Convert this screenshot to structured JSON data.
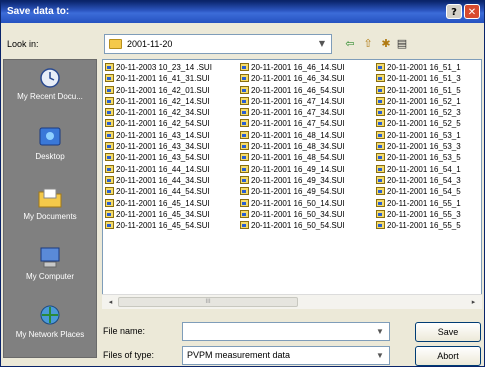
{
  "window": {
    "title": "Save data to:",
    "help": "?",
    "close": "✕"
  },
  "look_in": {
    "label": "Look in:",
    "value": "2001-11-20"
  },
  "toolbar": {
    "back": "⇦",
    "up": "⇧",
    "new_folder": "✱",
    "views": "▤"
  },
  "places": [
    "My Recent Docu...",
    "Desktop",
    "My Documents",
    "My Computer",
    "My Network Places"
  ],
  "files": {
    "col1": [
      "20-11-2003 10_23_14 .SUI",
      "20-11-2001 16_41_31.SUI",
      "20-11-2001 16_42_01.SUI",
      "20-11-2001 16_42_14.SUI",
      "20-11-2001 16_42_34.SUI",
      "20-11-2001 16_42_54.SUI",
      "20-11-2001 16_43_14.SUI",
      "20-11-2001 16_43_34.SUI",
      "20-11-2001 16_43_54.SUI",
      "20-11-2001 16_44_14.SUI",
      "20-11-2001 16_44_34.SUI",
      "20-11-2001 16_44_54.SUI",
      "20-11-2001 16_45_14.SUI",
      "20-11-2001 16_45_34.SUI",
      "20-11-2001 16_45_54.SUI"
    ],
    "col2": [
      "20-11-2001 16_46_14.SUI",
      "20-11-2001 16_46_34.SUI",
      "20-11-2001 16_46_54.SUI",
      "20-11-2001 16_47_14.SUI",
      "20-11-2001 16_47_34.SUI",
      "20-11-2001 16_47_54.SUI",
      "20-11-2001 16_48_14.SUI",
      "20-11-2001 16_48_34.SUI",
      "20-11-2001 16_48_54.SUI",
      "20-11-2001 16_49_14.SUI",
      "20-11-2001 16_49_34.SUI",
      "20-11-2001 16_49_54.SUI",
      "20-11-2001 16_50_14.SUI",
      "20-11-2001 16_50_34.SUI",
      "20-11-2001 16_50_54.SUI"
    ],
    "col3": [
      "20-11-2001 16_51_1",
      "20-11-2001 16_51_3",
      "20-11-2001 16_51_5",
      "20-11-2001 16_52_1",
      "20-11-2001 16_52_3",
      "20-11-2001 16_52_5",
      "20-11-2001 16_53_1",
      "20-11-2001 16_53_3",
      "20-11-2001 16_53_5",
      "20-11-2001 16_54_1",
      "20-11-2001 16_54_3",
      "20-11-2001 16_54_5",
      "20-11-2001 16_55_1",
      "20-11-2001 16_55_3",
      "20-11-2001 16_55_5"
    ]
  },
  "scroll": {
    "left": "◂",
    "right": "▸",
    "grip": "III"
  },
  "file_name": {
    "label": "File name:",
    "value": ""
  },
  "file_type": {
    "label": "Files of type:",
    "value": "PVPM measurement data"
  },
  "buttons": {
    "save": "Save",
    "abort": "Abort"
  }
}
